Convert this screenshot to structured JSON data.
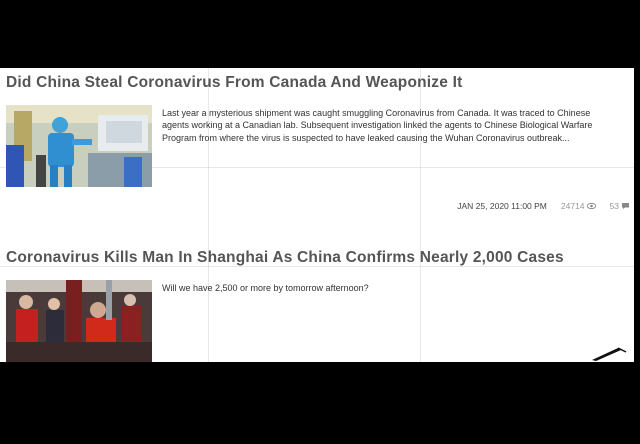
{
  "articles": [
    {
      "title": "Did China Steal Coronavirus From Canada And Weaponize It",
      "excerpt": "Last year a mysterious shipment was caught smuggling Coronavirus from Canada. It was traced to Chinese agents working at a Canadian lab. Subsequent investigation linked the agents to Chinese Biological Warfare Program from where the virus is suspected to have leaked causing the Wuhan Coronavirus outbreak...",
      "date": "JAN 25, 2020 11:00 PM",
      "views": "24714",
      "comments": "53",
      "thumbnail_icon": "lab-worker-photo"
    },
    {
      "title": "Coronavirus Kills Man In Shanghai As China Confirms Nearly 2,000 Cases",
      "excerpt": "Will we have 2,500 or more by tomorrow afternoon?",
      "thumbnail_icon": "subway-crowd-photo"
    }
  ],
  "icons": {
    "views": "eye-icon",
    "comments": "comment-icon",
    "pointer": "pen-pointer-icon"
  }
}
